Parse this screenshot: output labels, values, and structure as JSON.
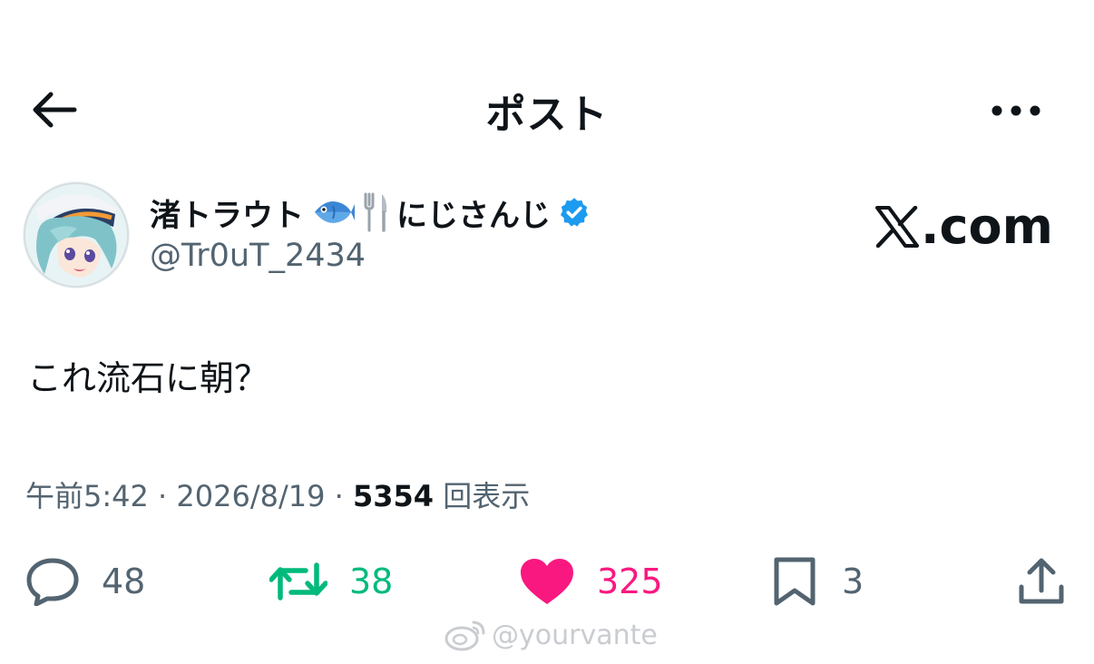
{
  "header": {
    "title": "ポスト",
    "back_icon": "arrow-left-icon",
    "more_icon": "more-horizontal-icon"
  },
  "author": {
    "display_name": "渚トラウト",
    "affiliation": "にじさんじ",
    "handle": "@Tr0uT_2434",
    "verified": true,
    "verified_color": "#1d9bf0",
    "name_emojis": [
      "fish-icon",
      "fork-knife-icon"
    ]
  },
  "brand": {
    "label": ".com",
    "logo": "x-logo-icon"
  },
  "post": {
    "text": "これ流石に朝？"
  },
  "meta": {
    "time": "午前5:42",
    "date": "2026/8/19",
    "views_count": "5354",
    "views_label": "回表示",
    "separator": "·"
  },
  "actions": {
    "reply_count": "48",
    "retweet_count": "38",
    "like_count": "325",
    "bookmark_count": "3"
  },
  "colors": {
    "text_primary": "#0f1419",
    "text_secondary": "#536471",
    "retweet_active": "#00ba7c",
    "like_active": "#f91880"
  },
  "watermark": {
    "text": "@yourvante"
  }
}
